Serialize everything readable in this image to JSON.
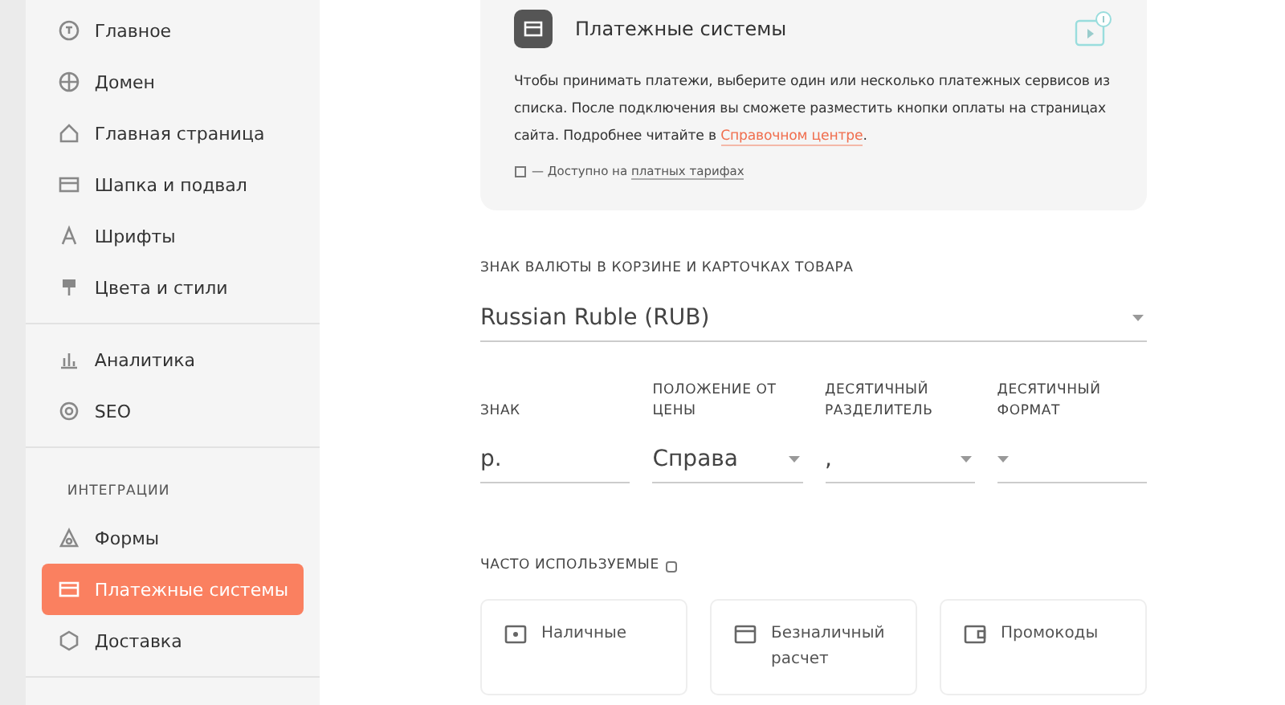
{
  "sidebar": {
    "groups": [
      {
        "items": [
          {
            "label": "Главное",
            "selected": false
          },
          {
            "label": "Домен",
            "selected": false
          },
          {
            "label": "Главная страница",
            "selected": false
          },
          {
            "label": "Шапка и подвал",
            "selected": false
          },
          {
            "label": "Шрифты",
            "selected": false
          },
          {
            "label": "Цвета и стили",
            "selected": false
          }
        ]
      },
      {
        "items": [
          {
            "label": "Аналитика",
            "selected": false
          },
          {
            "label": "SEO",
            "selected": false
          }
        ]
      },
      {
        "heading": "ИНТЕГРАЦИИ",
        "items": [
          {
            "label": "Формы",
            "selected": false
          },
          {
            "label": "Платежные системы",
            "selected": true
          },
          {
            "label": "Доставка",
            "selected": false
          }
        ]
      }
    ]
  },
  "info_card": {
    "title": "Платежные системы",
    "text": "Чтобы принимать платежи, выберите один или несколько платежных сервисов из списка. После подключения вы сможете разместить кнопки оплаты на страницах сайта. Подробнее читайте в ",
    "link": "Справочном центре",
    "text_end": ".",
    "note": "— Доступно на ",
    "note_link": "платных тарифах"
  },
  "currency": {
    "label": "ЗНАК ВАЛЮТЫ В КОРЗИНЕ И КАРТОЧКАХ ТОВАРА",
    "value": "Russian Ruble (RUB)"
  },
  "format_fields": [
    {
      "kind": "input",
      "label": "ЗНАК",
      "value": "р."
    },
    {
      "kind": "select",
      "label": "ПОЛОЖЕНИЕ ОТ ЦЕНЫ",
      "value": "Справа"
    },
    {
      "kind": "select",
      "label": "ДЕСЯТИЧНЫЙ РАЗДЕЛИТЕЛЬ",
      "value": ","
    },
    {
      "kind": "select",
      "label": "ДЕСЯТИЧНЫЙ ФОРМАТ"
    }
  ],
  "frequent": {
    "heading": "ЧАСТО ИСПОЛЬЗУЕМЫЕ",
    "methods": [
      {
        "label": "Наличные"
      },
      {
        "label": "Безналичный расчет"
      },
      {
        "label": "Промокоды"
      }
    ]
  }
}
